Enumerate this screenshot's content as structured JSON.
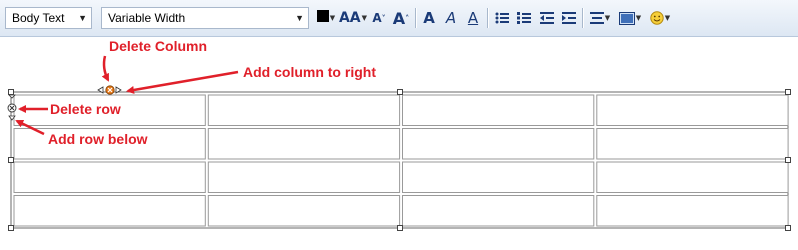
{
  "toolbar": {
    "style_select": "Body Text",
    "font_select": "Variable Width",
    "buttons": {
      "font_size_label": "AA",
      "smaller_label": "A",
      "larger_label": "A",
      "bold_label": "A",
      "italic_label": "A",
      "underline_label": "A"
    }
  },
  "annotations": {
    "delete_column": "Delete Column",
    "add_column_right": "Add column to right",
    "delete_row": "Delete row",
    "add_row_below": "Add row below"
  },
  "table": {
    "rows": 4,
    "columns": 4
  },
  "colors": {
    "annotation_red": "#e0202a",
    "toolbar_icon_blue": "#1b3b78",
    "delete_orange": "#e87a1a"
  }
}
